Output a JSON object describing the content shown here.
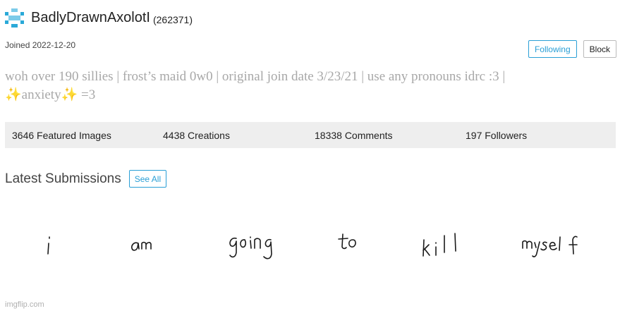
{
  "profile": {
    "username": "BadlyDrawnAxolotI",
    "user_id": "(262371)",
    "joined": "Joined 2022-12-20",
    "bio_line1": "woh over 190 sillies | frost’s maid 0w0 | original join date 3/23/21 | use any pronouns idrc :3 |",
    "bio_line2": "✨anxiety✨ =3"
  },
  "actions": {
    "following_label": "Following",
    "block_label": "Block"
  },
  "stats": {
    "featured": "3646 Featured Images",
    "creations": "4438 Creations",
    "comments": "18338 Comments",
    "followers": "197 Followers"
  },
  "latest": {
    "title": "Latest Submissions",
    "see_all_label": "See All"
  },
  "submission_image": {
    "words": [
      "i",
      "am",
      "going",
      "to",
      "kill",
      "myself"
    ]
  },
  "watermark": "imgflip.com",
  "colors": {
    "accent": "#2a9fd6",
    "bio_text": "#a8a8a8",
    "stats_bg": "#eeeeee",
    "avatar": "#2aa9d8"
  }
}
